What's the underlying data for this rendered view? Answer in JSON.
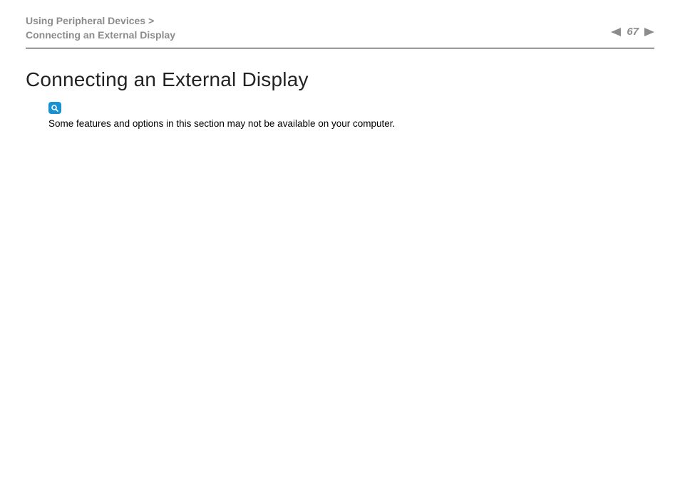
{
  "breadcrumb": {
    "parent": "Using Peripheral Devices",
    "separator": ">",
    "current": "Connecting an External Display"
  },
  "pager": {
    "page_number": "67"
  },
  "title": "Connecting an External Display",
  "note": {
    "icon": "magnifier-icon",
    "text": "Some features and options in this section may not be available on your computer."
  }
}
